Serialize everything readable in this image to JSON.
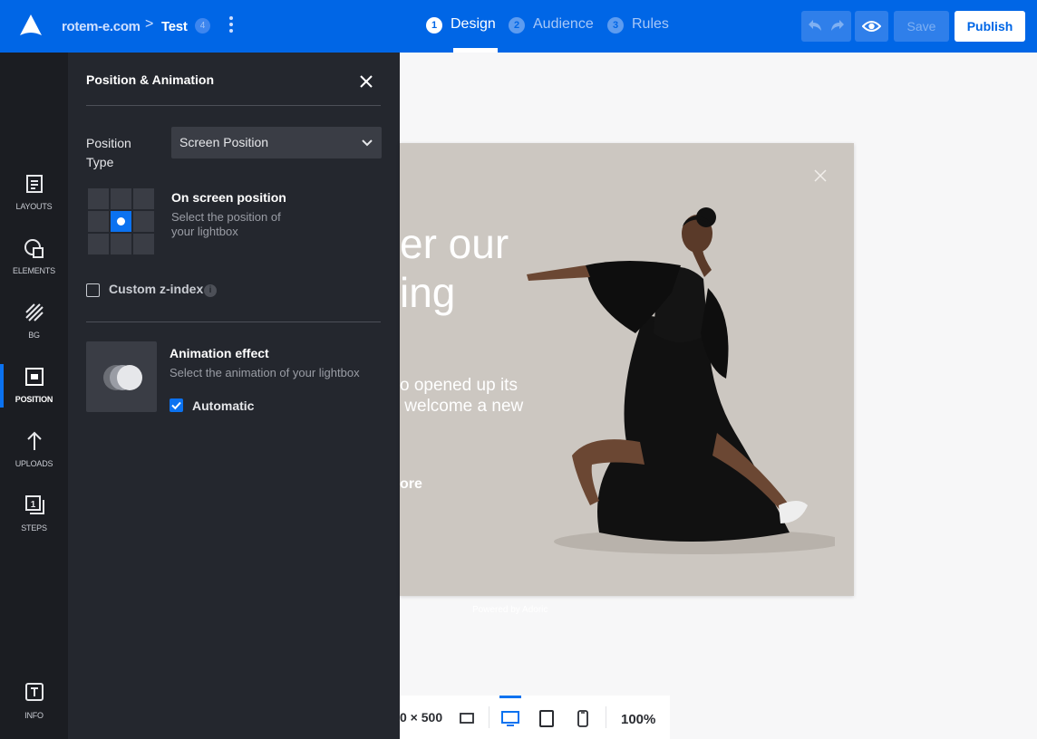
{
  "topbar": {
    "site": "rotem-e.com",
    "separator": ">",
    "page": "Test",
    "badge": "4",
    "steps": [
      {
        "num": "1",
        "label": "Design"
      },
      {
        "num": "2",
        "label": "Audience"
      },
      {
        "num": "3",
        "label": "Rules"
      }
    ],
    "save_label": "Save",
    "publish_label": "Publish"
  },
  "leftnav": {
    "items": [
      {
        "label": "LAYOUTS",
        "icon": "layouts-icon"
      },
      {
        "label": "ELEMENTS",
        "icon": "elements-icon"
      },
      {
        "label": "BG",
        "icon": "background-icon"
      },
      {
        "label": "POSITION",
        "icon": "position-icon"
      },
      {
        "label": "UPLOADS",
        "icon": "upload-icon"
      },
      {
        "label": "STEPS",
        "icon": "steps-icon"
      },
      {
        "label": "INFO",
        "icon": "info-text-icon"
      }
    ],
    "active": "POSITION"
  },
  "panel": {
    "title": "Position & Animation",
    "position_type_label": "Position Type",
    "position_type_value": "Screen Position",
    "onscreen_title": "On screen position",
    "onscreen_sub": "Select the position of your lightbox",
    "custom_zindex_label": "Custom z-index",
    "custom_zindex_checked": false,
    "info_glyph": "i",
    "animation_title": "Animation effect",
    "animation_sub": "Select the animation of your lightbox",
    "automatic_label": "Automatic",
    "automatic_checked": true
  },
  "canvas": {
    "popup": {
      "headline": "er our\ning",
      "body": "o opened up its\n welcome a new",
      "cta": "ore",
      "powered_by": "Powered by Adoric"
    },
    "dimensions": "0 × 500",
    "zoom": "100%",
    "active_device": "desktop"
  },
  "colors": {
    "brand_blue": "#0066e6",
    "accent_blue": "#0b72f0",
    "panel_bg": "#24272e",
    "nav_bg": "#1b1d22",
    "popup_bg": "#ccc7c1"
  }
}
